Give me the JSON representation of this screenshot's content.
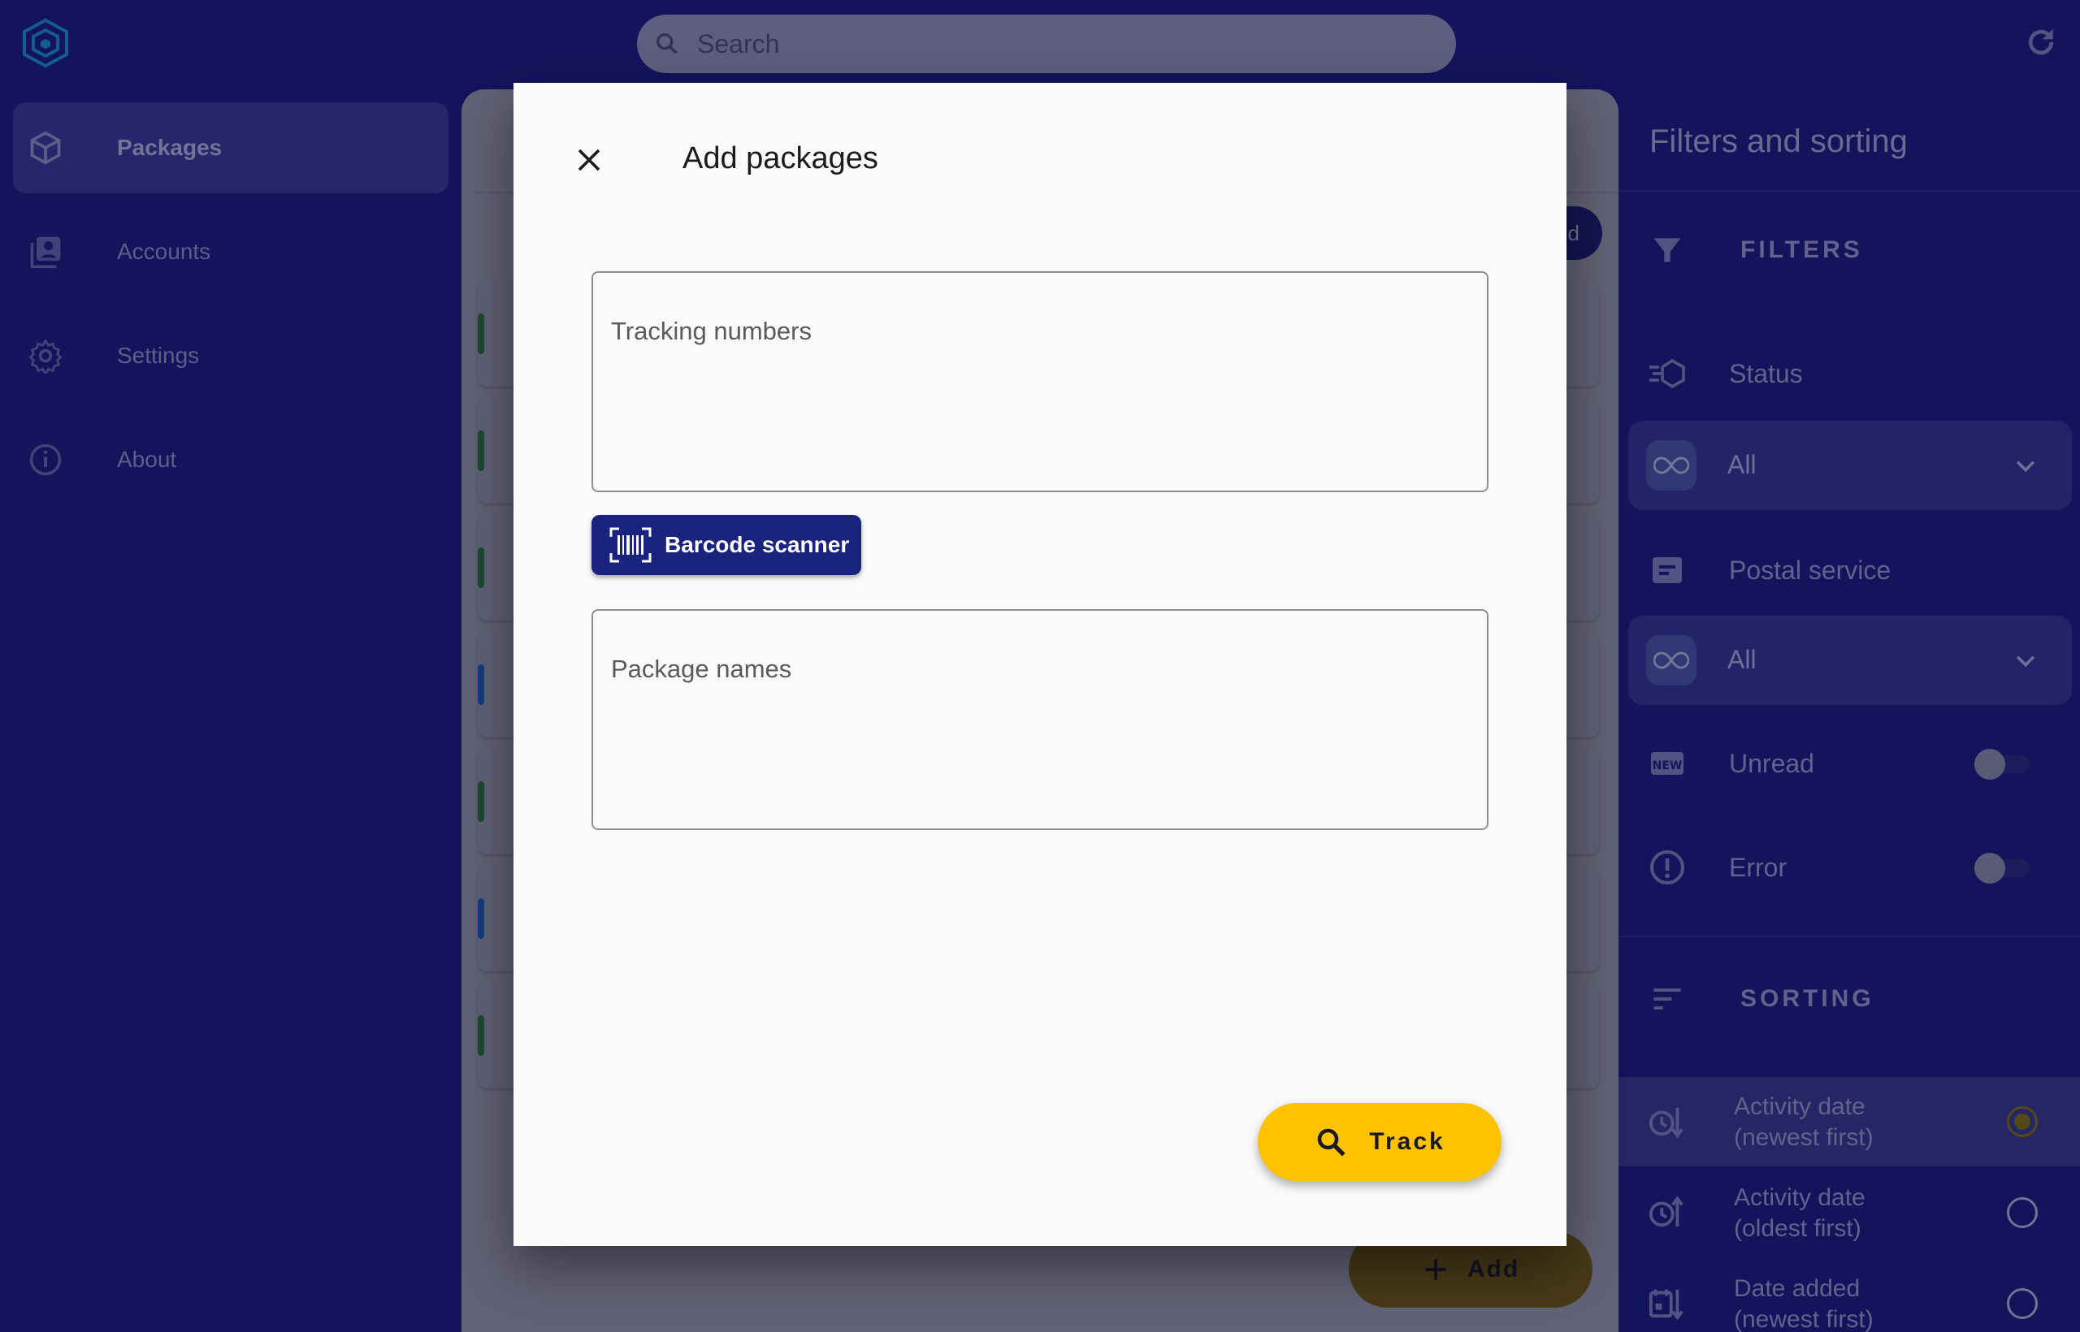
{
  "search": {
    "placeholder": "Search"
  },
  "sidebar": {
    "items": [
      {
        "label": "Packages",
        "icon": "package-icon",
        "active": true
      },
      {
        "label": "Accounts",
        "icon": "accounts-icon",
        "active": false
      },
      {
        "label": "Settings",
        "icon": "gear-icon",
        "active": false
      },
      {
        "label": "About",
        "icon": "info-icon",
        "active": false
      }
    ]
  },
  "main": {
    "partial_button_label": "d",
    "add_label": "Add"
  },
  "filters_panel": {
    "title": "Filters and sorting",
    "filters_heading": "FILTERS",
    "status_label": "Status",
    "status_value": "All",
    "postal_label": "Postal service",
    "postal_value": "All",
    "unread_label": "Unread",
    "unread_on": false,
    "error_label": "Error",
    "error_on": false,
    "sorting_heading": "SORTING",
    "sort_options": [
      {
        "line1": "Activity date",
        "line2": "(newest first)",
        "selected": true
      },
      {
        "line1": "Activity date",
        "line2": "(oldest first)",
        "selected": false
      },
      {
        "line1": "Date added",
        "line2": "(newest first)",
        "selected": false
      }
    ]
  },
  "dialog": {
    "title": "Add packages",
    "tracking_placeholder": "Tracking numbers",
    "barcode_label": "Barcode scanner",
    "names_placeholder": "Package names",
    "track_label": "Track"
  },
  "colors": {
    "background": "#1a1c7e",
    "accent_yellow": "#ffc200",
    "primary_blue": "#1a2280",
    "dialog_bg": "#fafafa"
  }
}
